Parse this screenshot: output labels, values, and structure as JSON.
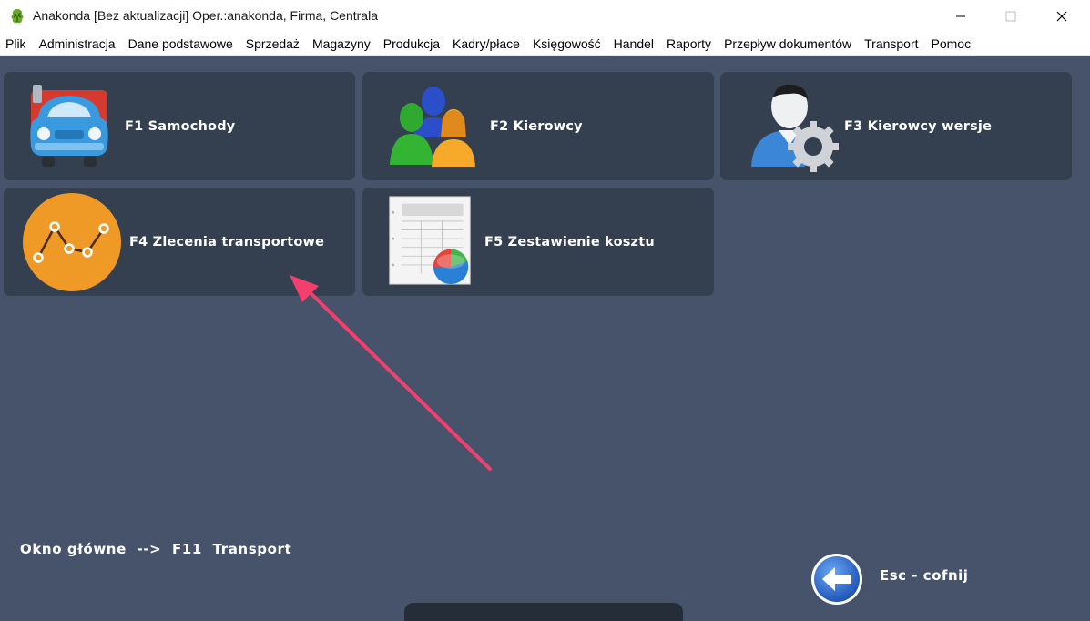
{
  "window": {
    "title": "Anakonda [Bez aktualizacji] Oper.:anakonda, Firma, Centrala"
  },
  "menu": [
    "Plik",
    "Administracja",
    "Dane podstawowe",
    "Sprzedaż",
    "Magazyny",
    "Produkcja",
    "Kadry/płace",
    "Księgowość",
    "Handel",
    "Raporty",
    "Przepływ dokumentów",
    "Transport",
    "Pomoc"
  ],
  "tiles": {
    "samochody": {
      "label": "F1  Samochody",
      "icon": "car-icon"
    },
    "kierowcy": {
      "label": "F2  Kierowcy",
      "icon": "people-icon"
    },
    "kierowcy_wersje": {
      "label": "F3  Kierowcy wersje",
      "icon": "user-gear-icon"
    },
    "zlecenia": {
      "label": "F4  Zlecenia transportowe",
      "icon": "line-chart-icon"
    },
    "zestawienie": {
      "label": "F5  Zestawienie kosztu",
      "icon": "report-pie-icon"
    }
  },
  "breadcrumb": "Okno główne  -->  F11  Transport",
  "back": {
    "label": "Esc - cofnij",
    "icon": "back-arrow-icon"
  },
  "colors": {
    "background": "#46536a",
    "tile": "#34404f",
    "annotation_arrow": "#f23f6e"
  }
}
